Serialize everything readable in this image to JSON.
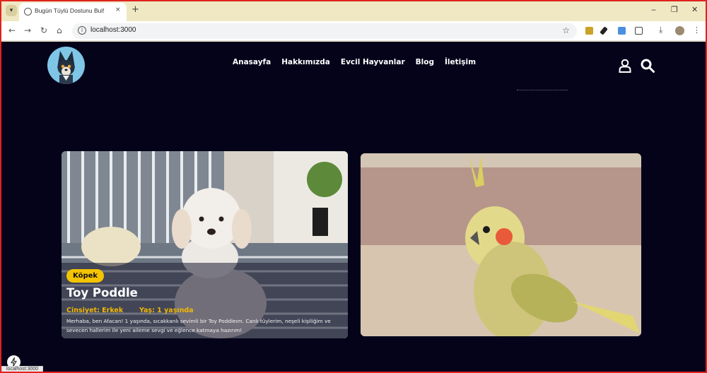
{
  "browser": {
    "tab_title": "Bugün Tüylü Dostunu Bul!",
    "tab_close": "×",
    "new_tab": "+",
    "url": "localhost:3000",
    "window_controls": [
      "‒",
      "❐",
      "✕"
    ],
    "status_url": "localhost:3000"
  },
  "site": {
    "nav": [
      "Anasayfa",
      "Hakkımızda",
      "Evcil Hayvanlar",
      "Blog",
      "İletişim"
    ]
  },
  "pet_card": {
    "badge": "Köpek",
    "name": "Toy Poddle",
    "gender": "Cinsiyet: Erkek",
    "age": "Yaş: 1 yaşında",
    "description": "Merhaba, ben Afacan! 1 yaşında, sıcakkanlı sevimli bir Toy Poddleım. Canlı tüylerim, neşeli kişiliğim ve sevecen hallerim ile yeni aileme sevgi ve eğlence katmaya hazırım!"
  },
  "colors": {
    "page_bg": "#04031a",
    "accent": "#f5c400",
    "meta": "#f2b705"
  }
}
